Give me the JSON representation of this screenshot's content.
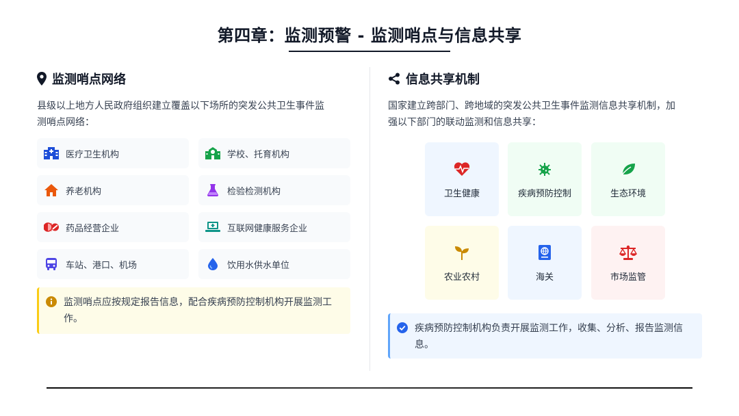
{
  "page": {
    "title": "第四章：监测预警 - 监测哨点与信息共享"
  },
  "left": {
    "heading": "监测哨点网络",
    "intro_line1": "县级以上地方人民政府组织建立覆盖以下场所的突发公共卫生事件监",
    "intro_line2": "测哨点网络：",
    "items": [
      {
        "label": "医疗卫生机构",
        "icon": "hospital-icon",
        "color": "#1d4ed8"
      },
      {
        "label": "学校、托育机构",
        "icon": "school-icon",
        "color": "#16a34a"
      },
      {
        "label": "养老机构",
        "icon": "home-icon",
        "color": "#ea580c"
      },
      {
        "label": "检验检测机构",
        "icon": "flask-icon",
        "color": "#9333ea"
      },
      {
        "label": "药品经营企业",
        "icon": "pills-icon",
        "color": "#dc2626"
      },
      {
        "label": "互联网健康服务企业",
        "icon": "laptop-medical-icon",
        "color": "#0d9488"
      },
      {
        "label": "车站、港口、机场",
        "icon": "bus-icon",
        "color": "#4f46e5"
      },
      {
        "label": "饮用水供水单位",
        "icon": "water-drop-icon",
        "color": "#2563eb"
      }
    ],
    "note_line1": "监测哨点应按规定报告信息，配合疾病预防控制机构开展监测工",
    "note_line2": "作。"
  },
  "right": {
    "heading": "信息共享机制",
    "intro_line1": "国家建立跨部门、跨地域的突发公共卫生事件监测信息共享机制，加",
    "intro_line2": "强以下部门的联动监测和信息共享：",
    "departments": [
      {
        "label": "卫生健康",
        "icon": "heartbeat-icon",
        "color": "#dc2626",
        "bg": "#eff6ff"
      },
      {
        "label": "疾病预防控制",
        "icon": "virus-icon",
        "color": "#16a34a",
        "bg": "#f0fdf4"
      },
      {
        "label": "生态环境",
        "icon": "leaf-icon",
        "color": "#16a34a",
        "bg": "#f0fdf4"
      },
      {
        "label": "农业农村",
        "icon": "seedling-icon",
        "color": "#ca8a04",
        "bg": "#fefce8"
      },
      {
        "label": "海关",
        "icon": "passport-icon",
        "color": "#2563eb",
        "bg": "#eff6ff"
      },
      {
        "label": "市场监管",
        "icon": "balance-scale-icon",
        "color": "#dc2626",
        "bg": "#fef2f2"
      }
    ],
    "note_line1": "疾病预防控制机构负责开展监测工作，收集、分析、报告监测信",
    "note_line2": "息。"
  },
  "colors": {
    "accent_yellow": "#facc15",
    "accent_blue": "#60a5fa",
    "note_icon_yellow": "#ca8a04",
    "note_icon_blue": "#2563eb"
  }
}
